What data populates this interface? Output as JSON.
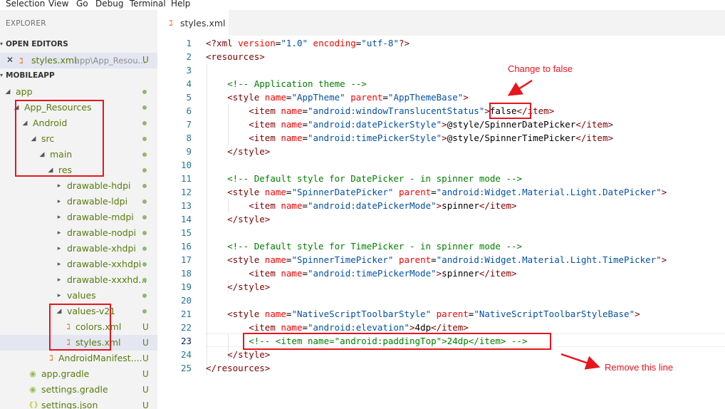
{
  "menu": [
    "Selection",
    "View",
    "Go",
    "Debug",
    "Terminal",
    "Help"
  ],
  "sidebar": {
    "explorer_title": "EXPLORER",
    "open_editors_title": "OPEN EDITORS",
    "open_editor": {
      "close": "✕",
      "name": "styles.xml",
      "path": "app\\App_Resou...",
      "status": "U"
    },
    "project_title": "MOBILEAPP",
    "tree": [
      {
        "label": "app",
        "status": "dot"
      },
      {
        "label": "App_Resources",
        "status": "dot"
      },
      {
        "label": "Android",
        "status": "dot"
      },
      {
        "label": "src",
        "status": "dot"
      },
      {
        "label": "main",
        "status": "dot"
      },
      {
        "label": "res",
        "status": "dot"
      },
      {
        "label": "drawable-hdpi",
        "status": "dot"
      },
      {
        "label": "drawable-ldpi",
        "status": "dot"
      },
      {
        "label": "drawable-mdpi",
        "status": "dot"
      },
      {
        "label": "drawable-nodpi",
        "status": "dot"
      },
      {
        "label": "drawable-xhdpi",
        "status": "dot"
      },
      {
        "label": "drawable-xxhdpi",
        "status": "dot"
      },
      {
        "label": "drawable-xxxhd...",
        "status": "dot"
      },
      {
        "label": "values",
        "status": "dot"
      },
      {
        "label": "values-v21",
        "status": "dot"
      },
      {
        "label": "colors.xml",
        "status": "U"
      },
      {
        "label": "styles.xml",
        "status": "U"
      },
      {
        "label": "AndroidManifest....",
        "status": "U"
      },
      {
        "label": "app.gradle",
        "status": "U"
      },
      {
        "label": "settings.gradle",
        "status": "U"
      },
      {
        "label": "settings.json",
        "status": "U"
      }
    ]
  },
  "tab": {
    "name": "styles.xml"
  },
  "editor": {
    "line_numbers": [
      "1",
      "2",
      "3",
      "4",
      "5",
      "6",
      "7",
      "8",
      "9",
      "10",
      "11",
      "12",
      "13",
      "14",
      "15",
      "16",
      "17",
      "18",
      "19",
      "20",
      "21",
      "22",
      "23",
      "24",
      "25"
    ],
    "active_line": "23"
  },
  "annotations": {
    "change_to_false": "Change to false",
    "remove_this_line": "Remove this line"
  },
  "colors": {
    "annotation_red": "#e8151d",
    "tag": "#800000",
    "attr": "#ff0000",
    "value": "#0451a5",
    "comment": "#008000"
  }
}
